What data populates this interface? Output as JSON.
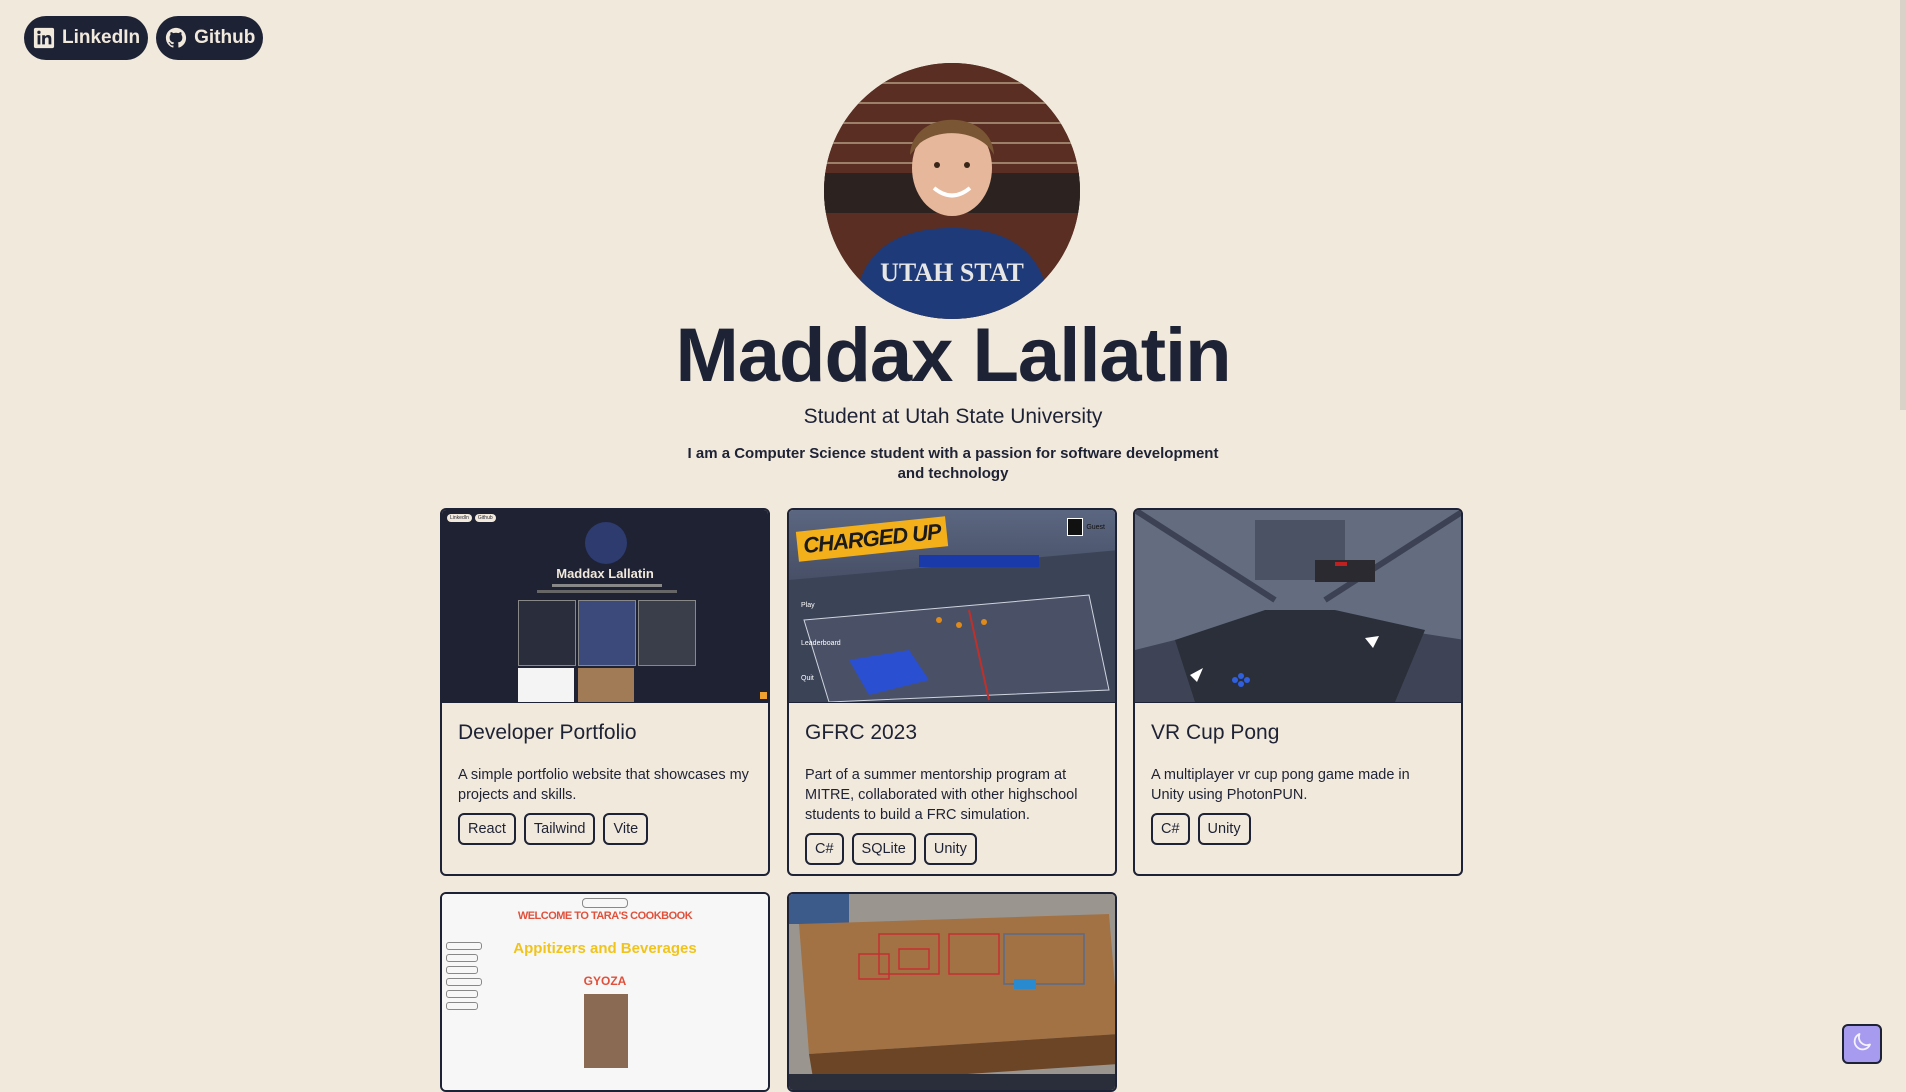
{
  "social": {
    "linkedin_label": "LinkedIn",
    "github_label": "Github"
  },
  "profile": {
    "name": "Maddax Lallatin",
    "subtitle": "Student at Utah State University",
    "bio": "I am a Computer Science student with a passion for software development and technology"
  },
  "projects": [
    {
      "title": "Developer Portfolio",
      "description": "A simple portfolio website that showcases my projects and skills.",
      "tags": [
        "React",
        "Tailwind",
        "Vite"
      ],
      "thumb": {
        "mini_name": "Maddax Lallatin",
        "mini_links": [
          "LinkedIn",
          "Github"
        ]
      }
    },
    {
      "title": "GFRC 2023",
      "description": "Part of a summer mentorship program at MITRE, collaborated with other highschool students to build a FRC simulation.",
      "tags": [
        "C#",
        "SQLite",
        "Unity"
      ],
      "thumb": {
        "banner": "CHARGED UP",
        "menu": [
          "Play",
          "Leaderboard",
          "Quit"
        ],
        "guest": "Guest"
      }
    },
    {
      "title": "VR Cup Pong",
      "description": "A multiplayer vr cup pong game made in Unity using PhotonPUN.",
      "tags": [
        "C#",
        "Unity"
      ]
    },
    {
      "thumb": {
        "heading": "WELCOME TO TARA'S COOKBOOK",
        "section": "Appitizers and Beverages",
        "dish": "GYOZA"
      }
    },
    {}
  ],
  "colors": {
    "background": "#f1e9dc",
    "ink": "#1e2235",
    "dark_toggle": "#a79bf0"
  },
  "icons": {
    "linkedin": "linkedin-icon",
    "github": "github-icon",
    "dark_mode": "moon-icon"
  }
}
